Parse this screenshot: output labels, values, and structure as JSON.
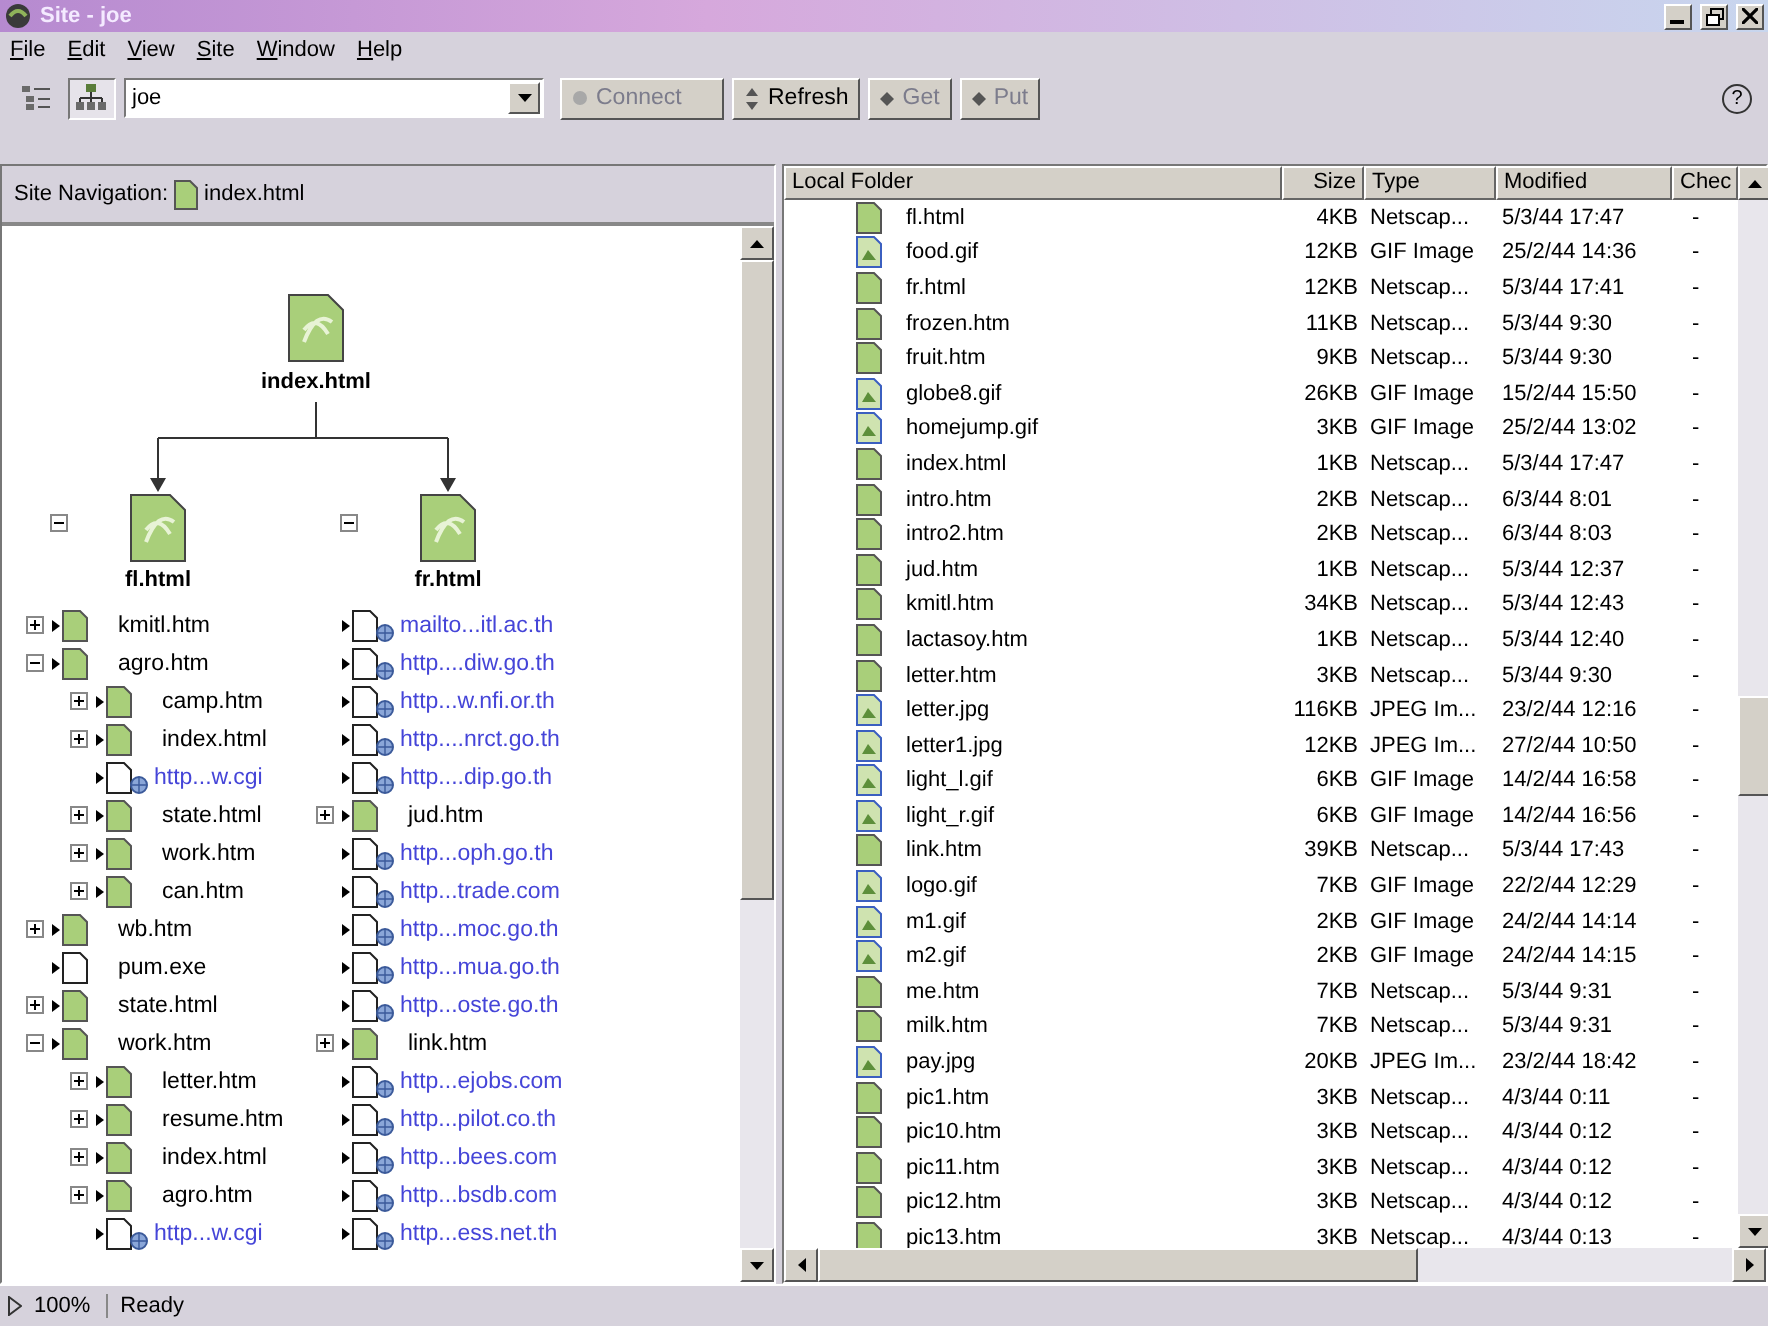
{
  "window": {
    "title": "Site - joe"
  },
  "menu": [
    "File",
    "Edit",
    "View",
    "Site",
    "Window",
    "Help"
  ],
  "toolbar": {
    "views": [
      {
        "kind": "files",
        "selected": false
      },
      {
        "kind": "map",
        "selected": true
      }
    ],
    "site": "joe",
    "buttons": [
      {
        "kind": "connect",
        "label": "Connect",
        "disabled": true
      },
      {
        "kind": "refresh",
        "label": "Refresh",
        "disabled": false
      },
      {
        "kind": "get",
        "label": "Get",
        "disabled": true
      },
      {
        "kind": "put",
        "label": "Put",
        "disabled": true
      }
    ],
    "help": "?"
  },
  "site_navigation": {
    "label": "Site Navigation:",
    "file": "index.html"
  },
  "site_map": {
    "root": "index.html",
    "branches": [
      {
        "label": "fl.html",
        "expanded": true,
        "children": [
          {
            "kind": "page",
            "label": "kmitl.htm",
            "expanded": false
          },
          {
            "kind": "page",
            "label": "agro.htm",
            "expanded": true,
            "children": [
              {
                "kind": "page",
                "label": "camp.htm",
                "expanded": false
              },
              {
                "kind": "page",
                "label": "index.html",
                "expanded": false
              },
              {
                "kind": "link",
                "label": "http...w.cgi"
              },
              {
                "kind": "page",
                "label": "state.html",
                "expanded": false
              },
              {
                "kind": "page",
                "label": "work.htm",
                "expanded": false
              },
              {
                "kind": "page",
                "label": "can.htm",
                "expanded": false
              }
            ]
          },
          {
            "kind": "page",
            "label": "wb.htm",
            "expanded": false
          },
          {
            "kind": "file",
            "label": "pum.exe"
          },
          {
            "kind": "page",
            "label": "state.html",
            "expanded": false
          },
          {
            "kind": "page",
            "label": "work.htm",
            "expanded": true,
            "children": [
              {
                "kind": "page",
                "label": "letter.htm",
                "expanded": false
              },
              {
                "kind": "page",
                "label": "resume.htm",
                "expanded": false
              },
              {
                "kind": "page",
                "label": "index.html",
                "expanded": false
              },
              {
                "kind": "page",
                "label": "agro.htm",
                "expanded": false
              },
              {
                "kind": "link",
                "label": "http...w.cgi"
              }
            ]
          }
        ]
      },
      {
        "label": "fr.html",
        "expanded": true,
        "children": [
          {
            "kind": "link",
            "label": "mailto...itl.ac.th"
          },
          {
            "kind": "link",
            "label": "http....diw.go.th"
          },
          {
            "kind": "link",
            "label": "http...w.nfi.or.th"
          },
          {
            "kind": "link",
            "label": "http....nrct.go.th"
          },
          {
            "kind": "link",
            "label": "http....dip.go.th"
          },
          {
            "kind": "page",
            "label": "jud.htm",
            "expanded": false
          },
          {
            "kind": "link",
            "label": "http...oph.go.th"
          },
          {
            "kind": "link",
            "label": "http...trade.com"
          },
          {
            "kind": "link",
            "label": "http...moc.go.th"
          },
          {
            "kind": "link",
            "label": "http...mua.go.th"
          },
          {
            "kind": "link",
            "label": "http...oste.go.th"
          },
          {
            "kind": "page",
            "label": "link.htm",
            "expanded": false
          },
          {
            "kind": "link",
            "label": "http...ejobs.com"
          },
          {
            "kind": "link",
            "label": "http...pilot.co.th"
          },
          {
            "kind": "link",
            "label": "http...bees.com"
          },
          {
            "kind": "link",
            "label": "http...bsdb.com"
          },
          {
            "kind": "link",
            "label": "http...ess.net.th"
          }
        ]
      }
    ]
  },
  "local_folder": {
    "columns": [
      "Local Folder",
      "Size",
      "Type",
      "Modified",
      "Chec"
    ],
    "rows": [
      {
        "kind": "page",
        "name": "fl.html",
        "size": "4KB",
        "type": "Netscap...",
        "modified": "5/3/44 17:47",
        "checked_out": "-"
      },
      {
        "kind": "image",
        "name": "food.gif",
        "size": "12KB",
        "type": "GIF Image",
        "modified": "25/2/44 14:36",
        "checked_out": "-"
      },
      {
        "kind": "page",
        "name": "fr.html",
        "size": "12KB",
        "type": "Netscap...",
        "modified": "5/3/44 17:41",
        "checked_out": "-"
      },
      {
        "kind": "page",
        "name": "frozen.htm",
        "size": "11KB",
        "type": "Netscap...",
        "modified": "5/3/44 9:30",
        "checked_out": "-"
      },
      {
        "kind": "page",
        "name": "fruit.htm",
        "size": "9KB",
        "type": "Netscap...",
        "modified": "5/3/44 9:30",
        "checked_out": "-"
      },
      {
        "kind": "image",
        "name": "globe8.gif",
        "size": "26KB",
        "type": "GIF Image",
        "modified": "15/2/44 15:50",
        "checked_out": "-"
      },
      {
        "kind": "image",
        "name": "homejump.gif",
        "size": "3KB",
        "type": "GIF Image",
        "modified": "25/2/44 13:02",
        "checked_out": "-"
      },
      {
        "kind": "page",
        "name": "index.html",
        "size": "1KB",
        "type": "Netscap...",
        "modified": "5/3/44 17:47",
        "checked_out": "-"
      },
      {
        "kind": "page",
        "name": "intro.htm",
        "size": "2KB",
        "type": "Netscap...",
        "modified": "6/3/44 8:01",
        "checked_out": "-"
      },
      {
        "kind": "page",
        "name": "intro2.htm",
        "size": "2KB",
        "type": "Netscap...",
        "modified": "6/3/44 8:03",
        "checked_out": "-"
      },
      {
        "kind": "page",
        "name": "jud.htm",
        "size": "1KB",
        "type": "Netscap...",
        "modified": "5/3/44 12:37",
        "checked_out": "-"
      },
      {
        "kind": "page",
        "name": "kmitl.htm",
        "size": "34KB",
        "type": "Netscap...",
        "modified": "5/3/44 12:43",
        "checked_out": "-"
      },
      {
        "kind": "page",
        "name": "lactasoy.htm",
        "size": "1KB",
        "type": "Netscap...",
        "modified": "5/3/44 12:40",
        "checked_out": "-"
      },
      {
        "kind": "page",
        "name": "letter.htm",
        "size": "3KB",
        "type": "Netscap...",
        "modified": "5/3/44 9:30",
        "checked_out": "-"
      },
      {
        "kind": "image",
        "name": "letter.jpg",
        "size": "116KB",
        "type": "JPEG Im...",
        "modified": "23/2/44 12:16",
        "checked_out": "-"
      },
      {
        "kind": "image",
        "name": "letter1.jpg",
        "size": "12KB",
        "type": "JPEG Im...",
        "modified": "27/2/44 10:50",
        "checked_out": "-"
      },
      {
        "kind": "image",
        "name": "light_l.gif",
        "size": "6KB",
        "type": "GIF Image",
        "modified": "14/2/44 16:58",
        "checked_out": "-"
      },
      {
        "kind": "image",
        "name": "light_r.gif",
        "size": "6KB",
        "type": "GIF Image",
        "modified": "14/2/44 16:56",
        "checked_out": "-"
      },
      {
        "kind": "page",
        "name": "link.htm",
        "size": "39KB",
        "type": "Netscap...",
        "modified": "5/3/44 17:43",
        "checked_out": "-"
      },
      {
        "kind": "image",
        "name": "logo.gif",
        "size": "7KB",
        "type": "GIF Image",
        "modified": "22/2/44 12:29",
        "checked_out": "-"
      },
      {
        "kind": "image",
        "name": "m1.gif",
        "size": "2KB",
        "type": "GIF Image",
        "modified": "24/2/44 14:14",
        "checked_out": "-"
      },
      {
        "kind": "image",
        "name": "m2.gif",
        "size": "2KB",
        "type": "GIF Image",
        "modified": "24/2/44 14:15",
        "checked_out": "-"
      },
      {
        "kind": "page",
        "name": "me.htm",
        "size": "7KB",
        "type": "Netscap...",
        "modified": "5/3/44 9:31",
        "checked_out": "-"
      },
      {
        "kind": "page",
        "name": "milk.htm",
        "size": "7KB",
        "type": "Netscap...",
        "modified": "5/3/44 9:31",
        "checked_out": "-"
      },
      {
        "kind": "image",
        "name": "pay.jpg",
        "size": "20KB",
        "type": "JPEG Im...",
        "modified": "23/2/44 18:42",
        "checked_out": "-"
      },
      {
        "kind": "page",
        "name": "pic1.htm",
        "size": "3KB",
        "type": "Netscap...",
        "modified": "4/3/44 0:11",
        "checked_out": "-"
      },
      {
        "kind": "page",
        "name": "pic10.htm",
        "size": "3KB",
        "type": "Netscap...",
        "modified": "4/3/44 0:12",
        "checked_out": "-"
      },
      {
        "kind": "page",
        "name": "pic11.htm",
        "size": "3KB",
        "type": "Netscap...",
        "modified": "4/3/44 0:12",
        "checked_out": "-"
      },
      {
        "kind": "page",
        "name": "pic12.htm",
        "size": "3KB",
        "type": "Netscap...",
        "modified": "4/3/44 0:12",
        "checked_out": "-"
      },
      {
        "kind": "page",
        "name": "pic13.htm",
        "size": "3KB",
        "type": "Netscap...",
        "modified": "4/3/44 0:13",
        "checked_out": "-"
      }
    ]
  },
  "status_bar": {
    "zoom": "100%",
    "message": "Ready"
  }
}
